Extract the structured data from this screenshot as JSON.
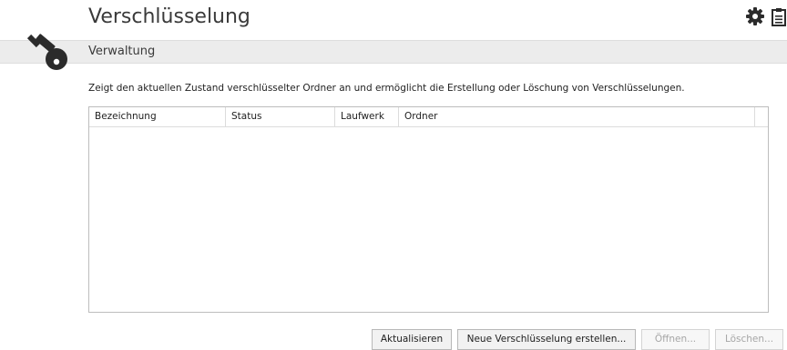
{
  "header": {
    "title": "Verschlüsselung",
    "settings_icon": "gear-icon",
    "report_icon": "clipboard-icon"
  },
  "section": {
    "title": "Verwaltung",
    "icon": "key-icon"
  },
  "description": "Zeigt den aktuellen Zustand verschlüsselter Ordner an und ermöglicht die Erstellung oder Löschung von Verschlüsselungen.",
  "table": {
    "columns": [
      "Bezeichnung",
      "Status",
      "Laufwerk",
      "Ordner"
    ],
    "rows": []
  },
  "buttons": {
    "refresh": "Aktualisieren",
    "new_encryption": "Neue Verschlüsselung erstellen...",
    "open": "Öffnen...",
    "delete": "Löschen..."
  },
  "colors": {
    "icon_dark": "#2b2b2b",
    "band_bg": "#ececec",
    "disabled_text": "#a6a6a6"
  }
}
